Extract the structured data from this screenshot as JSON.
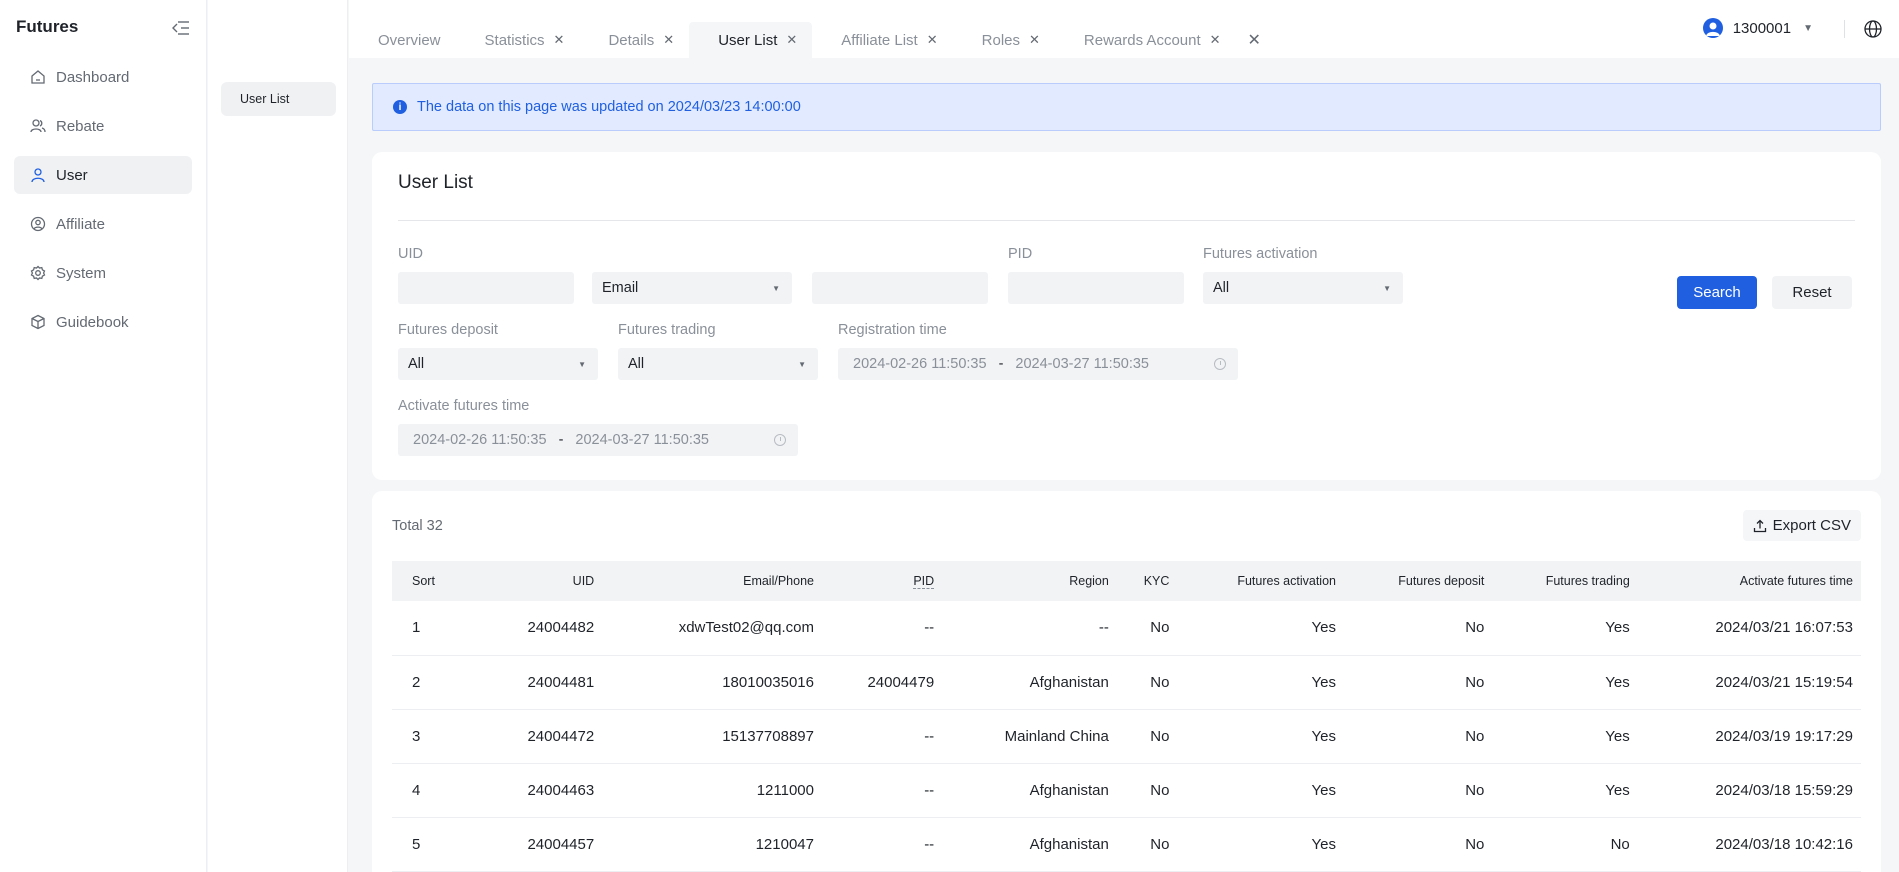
{
  "sidebar": {
    "brand": "Futures",
    "items": [
      {
        "label": "Dashboard",
        "icon": "home-icon",
        "active": false
      },
      {
        "label": "Rebate",
        "icon": "users-icon",
        "active": false
      },
      {
        "label": "User",
        "icon": "user-icon",
        "active": true
      },
      {
        "label": "Affiliate",
        "icon": "affiliate-icon",
        "active": false
      },
      {
        "label": "System",
        "icon": "gear-icon",
        "active": false
      },
      {
        "label": "Guidebook",
        "icon": "box-icon",
        "active": false
      }
    ]
  },
  "subnav": {
    "items": [
      {
        "label": "User List"
      }
    ]
  },
  "tabs": [
    {
      "label": "Overview",
      "closable": false,
      "active": false
    },
    {
      "label": "Statistics",
      "closable": true,
      "active": false
    },
    {
      "label": "Details",
      "closable": true,
      "active": false
    },
    {
      "label": "User List",
      "closable": true,
      "active": true
    },
    {
      "label": "Affiliate List",
      "closable": true,
      "active": false
    },
    {
      "label": "Roles",
      "closable": true,
      "active": false
    },
    {
      "label": "Rewards Account",
      "closable": true,
      "active": false
    }
  ],
  "header": {
    "account_id": "1300001"
  },
  "notice": "The data on this page was updated on 2024/03/23 14:00:00",
  "filters": {
    "title": "User List",
    "uid_label": "UID",
    "contact_type": "Email",
    "pid_label": "PID",
    "futures_activation_label": "Futures activation",
    "futures_activation_value": "All",
    "futures_deposit_label": "Futures deposit",
    "futures_deposit_value": "All",
    "futures_trading_label": "Futures trading",
    "futures_trading_value": "All",
    "registration_time_label": "Registration time",
    "registration_start": "2024-02-26 11:50:35",
    "registration_end": "2024-03-27 11:50:35",
    "activate_time_label": "Activate futures time",
    "activate_start": "2024-02-26 11:50:35",
    "activate_end": "2024-03-27 11:50:35",
    "range_separator": "-",
    "search_label": "Search",
    "reset_label": "Reset"
  },
  "table": {
    "total": "Total 32",
    "export_label": "Export CSV",
    "columns": [
      "Sort",
      "UID",
      "Email/Phone",
      "PID",
      "Region",
      "KYC",
      "Futures activation",
      "Futures deposit",
      "Futures trading",
      "Activate futures time"
    ],
    "rows": [
      [
        "1",
        "24004482",
        "xdwTest02@qq.com",
        "--",
        "--",
        "No",
        "Yes",
        "No",
        "Yes",
        "2024/03/21 16:07:53"
      ],
      [
        "2",
        "24004481",
        "18010035016",
        "24004479",
        "Afghanistan",
        "No",
        "Yes",
        "No",
        "Yes",
        "2024/03/21 15:19:54"
      ],
      [
        "3",
        "24004472",
        "15137708897",
        "--",
        "Mainland China",
        "No",
        "Yes",
        "No",
        "Yes",
        "2024/03/19 19:17:29"
      ],
      [
        "4",
        "24004463",
        "1211000",
        "--",
        "Afghanistan",
        "No",
        "Yes",
        "No",
        "Yes",
        "2024/03/18 15:59:29"
      ],
      [
        "5",
        "24004457",
        "1210047",
        "--",
        "Afghanistan",
        "No",
        "Yes",
        "No",
        "No",
        "2024/03/18 10:42:16"
      ]
    ]
  },
  "colors": {
    "accent": "#1f5fe0",
    "notice_bg": "#e1eaff",
    "page_bg": "#f5f6f8"
  }
}
